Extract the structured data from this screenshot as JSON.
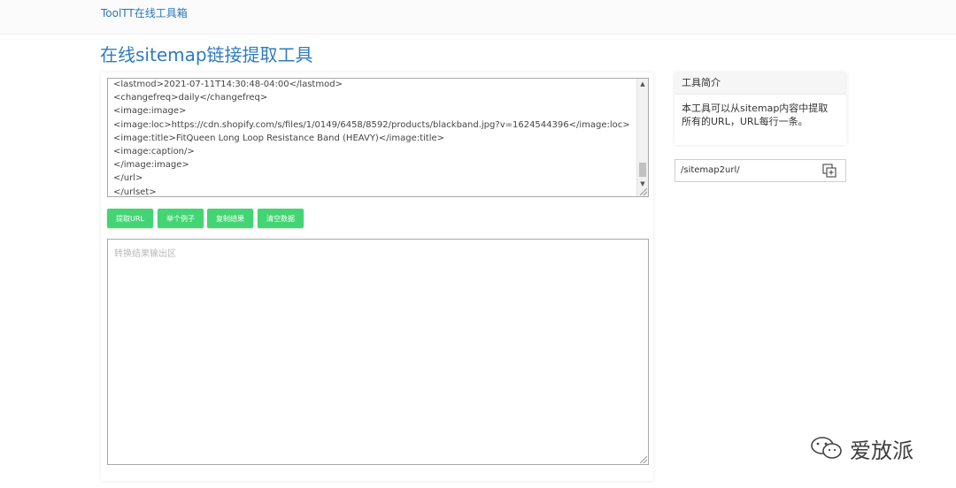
{
  "header": {
    "brand": "ToolTT在线工具箱"
  },
  "page_title": "在线sitemap链接提取工具",
  "input": {
    "lines": [
      "<lastmod>2021-07-11T14:30:48-04:00</lastmod>",
      "<changefreq>daily</changefreq>",
      "<image:image>",
      "<image:loc>https://cdn.shopify.com/s/files/1/0149/6458/8592/products/blackband.jpg?v=1624544396</image:loc>",
      "<image:title>FitQueen Long Loop Resistance Band (HEAVY)</image:title>",
      "<image:caption/>",
      "</image:image>",
      "</url>",
      "</urlset>"
    ]
  },
  "buttons": {
    "extract": "提取URL",
    "example": "举个例子",
    "copy": "复制结果",
    "clear": "清空数据"
  },
  "output": {
    "placeholder": "转换结果输出区"
  },
  "sidebar": {
    "title": "工具简介",
    "description_line1": "本工具可以从sitemap内容中提取",
    "description_line2": "所有的URL，URL每行一条。"
  },
  "url_box": {
    "path": "/sitemap2url/",
    "icon": "copy-add-icon"
  },
  "watermark": {
    "text": "爱放派",
    "icon": "wechat-icon"
  }
}
